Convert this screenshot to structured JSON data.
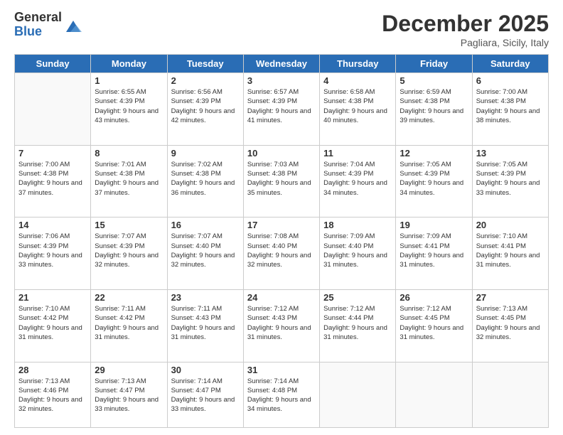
{
  "logo": {
    "general": "General",
    "blue": "Blue"
  },
  "header": {
    "month": "December 2025",
    "location": "Pagliara, Sicily, Italy"
  },
  "weekdays": [
    "Sunday",
    "Monday",
    "Tuesday",
    "Wednesday",
    "Thursday",
    "Friday",
    "Saturday"
  ],
  "weeks": [
    [
      {
        "day": "",
        "sunrise": "",
        "sunset": "",
        "daylight": ""
      },
      {
        "day": "1",
        "sunrise": "Sunrise: 6:55 AM",
        "sunset": "Sunset: 4:39 PM",
        "daylight": "Daylight: 9 hours and 43 minutes."
      },
      {
        "day": "2",
        "sunrise": "Sunrise: 6:56 AM",
        "sunset": "Sunset: 4:39 PM",
        "daylight": "Daylight: 9 hours and 42 minutes."
      },
      {
        "day": "3",
        "sunrise": "Sunrise: 6:57 AM",
        "sunset": "Sunset: 4:39 PM",
        "daylight": "Daylight: 9 hours and 41 minutes."
      },
      {
        "day": "4",
        "sunrise": "Sunrise: 6:58 AM",
        "sunset": "Sunset: 4:38 PM",
        "daylight": "Daylight: 9 hours and 40 minutes."
      },
      {
        "day": "5",
        "sunrise": "Sunrise: 6:59 AM",
        "sunset": "Sunset: 4:38 PM",
        "daylight": "Daylight: 9 hours and 39 minutes."
      },
      {
        "day": "6",
        "sunrise": "Sunrise: 7:00 AM",
        "sunset": "Sunset: 4:38 PM",
        "daylight": "Daylight: 9 hours and 38 minutes."
      }
    ],
    [
      {
        "day": "7",
        "sunrise": "Sunrise: 7:00 AM",
        "sunset": "Sunset: 4:38 PM",
        "daylight": "Daylight: 9 hours and 37 minutes."
      },
      {
        "day": "8",
        "sunrise": "Sunrise: 7:01 AM",
        "sunset": "Sunset: 4:38 PM",
        "daylight": "Daylight: 9 hours and 37 minutes."
      },
      {
        "day": "9",
        "sunrise": "Sunrise: 7:02 AM",
        "sunset": "Sunset: 4:38 PM",
        "daylight": "Daylight: 9 hours and 36 minutes."
      },
      {
        "day": "10",
        "sunrise": "Sunrise: 7:03 AM",
        "sunset": "Sunset: 4:38 PM",
        "daylight": "Daylight: 9 hours and 35 minutes."
      },
      {
        "day": "11",
        "sunrise": "Sunrise: 7:04 AM",
        "sunset": "Sunset: 4:39 PM",
        "daylight": "Daylight: 9 hours and 34 minutes."
      },
      {
        "day": "12",
        "sunrise": "Sunrise: 7:05 AM",
        "sunset": "Sunset: 4:39 PM",
        "daylight": "Daylight: 9 hours and 34 minutes."
      },
      {
        "day": "13",
        "sunrise": "Sunrise: 7:05 AM",
        "sunset": "Sunset: 4:39 PM",
        "daylight": "Daylight: 9 hours and 33 minutes."
      }
    ],
    [
      {
        "day": "14",
        "sunrise": "Sunrise: 7:06 AM",
        "sunset": "Sunset: 4:39 PM",
        "daylight": "Daylight: 9 hours and 33 minutes."
      },
      {
        "day": "15",
        "sunrise": "Sunrise: 7:07 AM",
        "sunset": "Sunset: 4:39 PM",
        "daylight": "Daylight: 9 hours and 32 minutes."
      },
      {
        "day": "16",
        "sunrise": "Sunrise: 7:07 AM",
        "sunset": "Sunset: 4:40 PM",
        "daylight": "Daylight: 9 hours and 32 minutes."
      },
      {
        "day": "17",
        "sunrise": "Sunrise: 7:08 AM",
        "sunset": "Sunset: 4:40 PM",
        "daylight": "Daylight: 9 hours and 32 minutes."
      },
      {
        "day": "18",
        "sunrise": "Sunrise: 7:09 AM",
        "sunset": "Sunset: 4:40 PM",
        "daylight": "Daylight: 9 hours and 31 minutes."
      },
      {
        "day": "19",
        "sunrise": "Sunrise: 7:09 AM",
        "sunset": "Sunset: 4:41 PM",
        "daylight": "Daylight: 9 hours and 31 minutes."
      },
      {
        "day": "20",
        "sunrise": "Sunrise: 7:10 AM",
        "sunset": "Sunset: 4:41 PM",
        "daylight": "Daylight: 9 hours and 31 minutes."
      }
    ],
    [
      {
        "day": "21",
        "sunrise": "Sunrise: 7:10 AM",
        "sunset": "Sunset: 4:42 PM",
        "daylight": "Daylight: 9 hours and 31 minutes."
      },
      {
        "day": "22",
        "sunrise": "Sunrise: 7:11 AM",
        "sunset": "Sunset: 4:42 PM",
        "daylight": "Daylight: 9 hours and 31 minutes."
      },
      {
        "day": "23",
        "sunrise": "Sunrise: 7:11 AM",
        "sunset": "Sunset: 4:43 PM",
        "daylight": "Daylight: 9 hours and 31 minutes."
      },
      {
        "day": "24",
        "sunrise": "Sunrise: 7:12 AM",
        "sunset": "Sunset: 4:43 PM",
        "daylight": "Daylight: 9 hours and 31 minutes."
      },
      {
        "day": "25",
        "sunrise": "Sunrise: 7:12 AM",
        "sunset": "Sunset: 4:44 PM",
        "daylight": "Daylight: 9 hours and 31 minutes."
      },
      {
        "day": "26",
        "sunrise": "Sunrise: 7:12 AM",
        "sunset": "Sunset: 4:45 PM",
        "daylight": "Daylight: 9 hours and 31 minutes."
      },
      {
        "day": "27",
        "sunrise": "Sunrise: 7:13 AM",
        "sunset": "Sunset: 4:45 PM",
        "daylight": "Daylight: 9 hours and 32 minutes."
      }
    ],
    [
      {
        "day": "28",
        "sunrise": "Sunrise: 7:13 AM",
        "sunset": "Sunset: 4:46 PM",
        "daylight": "Daylight: 9 hours and 32 minutes."
      },
      {
        "day": "29",
        "sunrise": "Sunrise: 7:13 AM",
        "sunset": "Sunset: 4:47 PM",
        "daylight": "Daylight: 9 hours and 33 minutes."
      },
      {
        "day": "30",
        "sunrise": "Sunrise: 7:14 AM",
        "sunset": "Sunset: 4:47 PM",
        "daylight": "Daylight: 9 hours and 33 minutes."
      },
      {
        "day": "31",
        "sunrise": "Sunrise: 7:14 AM",
        "sunset": "Sunset: 4:48 PM",
        "daylight": "Daylight: 9 hours and 34 minutes."
      },
      {
        "day": "",
        "sunrise": "",
        "sunset": "",
        "daylight": ""
      },
      {
        "day": "",
        "sunrise": "",
        "sunset": "",
        "daylight": ""
      },
      {
        "day": "",
        "sunrise": "",
        "sunset": "",
        "daylight": ""
      }
    ]
  ]
}
